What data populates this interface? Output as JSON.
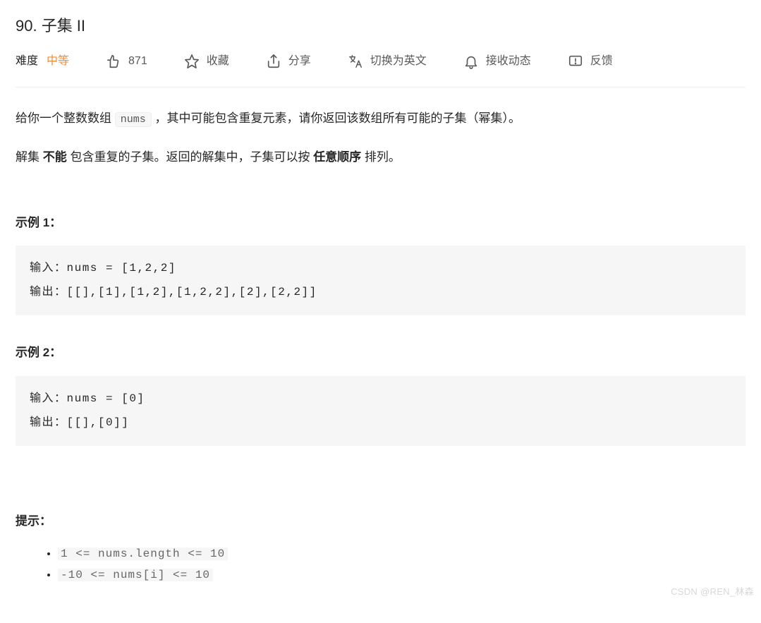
{
  "title": "90. 子集 II",
  "meta": {
    "difficulty_label": "难度",
    "difficulty_value": "中等",
    "like_count": "871",
    "favorite": "收藏",
    "share": "分享",
    "translate": "切换为英文",
    "subscribe": "接收动态",
    "feedback": "反馈"
  },
  "description": {
    "line1_pre": "给你一个整数数组 ",
    "line1_code": "nums",
    "line1_post": " ，其中可能包含重复元素，请你返回该数组所有可能的子集（幂集）。",
    "line2_a": "解集 ",
    "line2_b": "不能",
    "line2_c": " 包含重复的子集。返回的解集中，子集可以按 ",
    "line2_d": "任意顺序",
    "line2_e": " 排列。"
  },
  "examples": {
    "heading1": "示例 1：",
    "ex1_line1": "输入：nums = [1,2,2]",
    "ex1_line2": "输出：[[],[1],[1,2],[1,2,2],[2],[2,2]]",
    "heading2": "示例 2：",
    "ex2_line1": "输入：nums = [0]",
    "ex2_line2": "输出：[[],[0]]"
  },
  "hints": {
    "heading": "提示：",
    "c1": "1 <= nums.length <= 10",
    "c2": "-10 <= nums[i] <= 10"
  },
  "watermark": "CSDN @REN_林森"
}
